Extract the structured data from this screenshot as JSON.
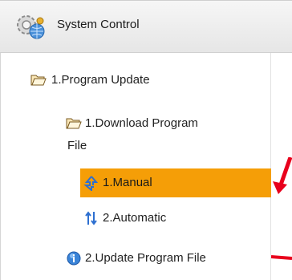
{
  "header": {
    "title": "System Control",
    "icon": "gear-globe-icon"
  },
  "tree": {
    "program_update": {
      "label": "1.Program Update",
      "icon": "folder-open-icon"
    },
    "download_program_file": {
      "label_line1": "1.Download Program",
      "label_line2": "File",
      "icon": "folder-open-icon"
    },
    "manual": {
      "label": "1.Manual",
      "icon": "sync-arrows-icon",
      "selected": true
    },
    "automatic": {
      "label": "2.Automatic",
      "icon": "up-down-arrows-icon"
    },
    "update_program_file": {
      "label": "2.Update Program File",
      "icon": "info-globe-icon"
    }
  },
  "colors": {
    "selection": "#f59e07",
    "annotation_arrow": "#e8001c"
  }
}
